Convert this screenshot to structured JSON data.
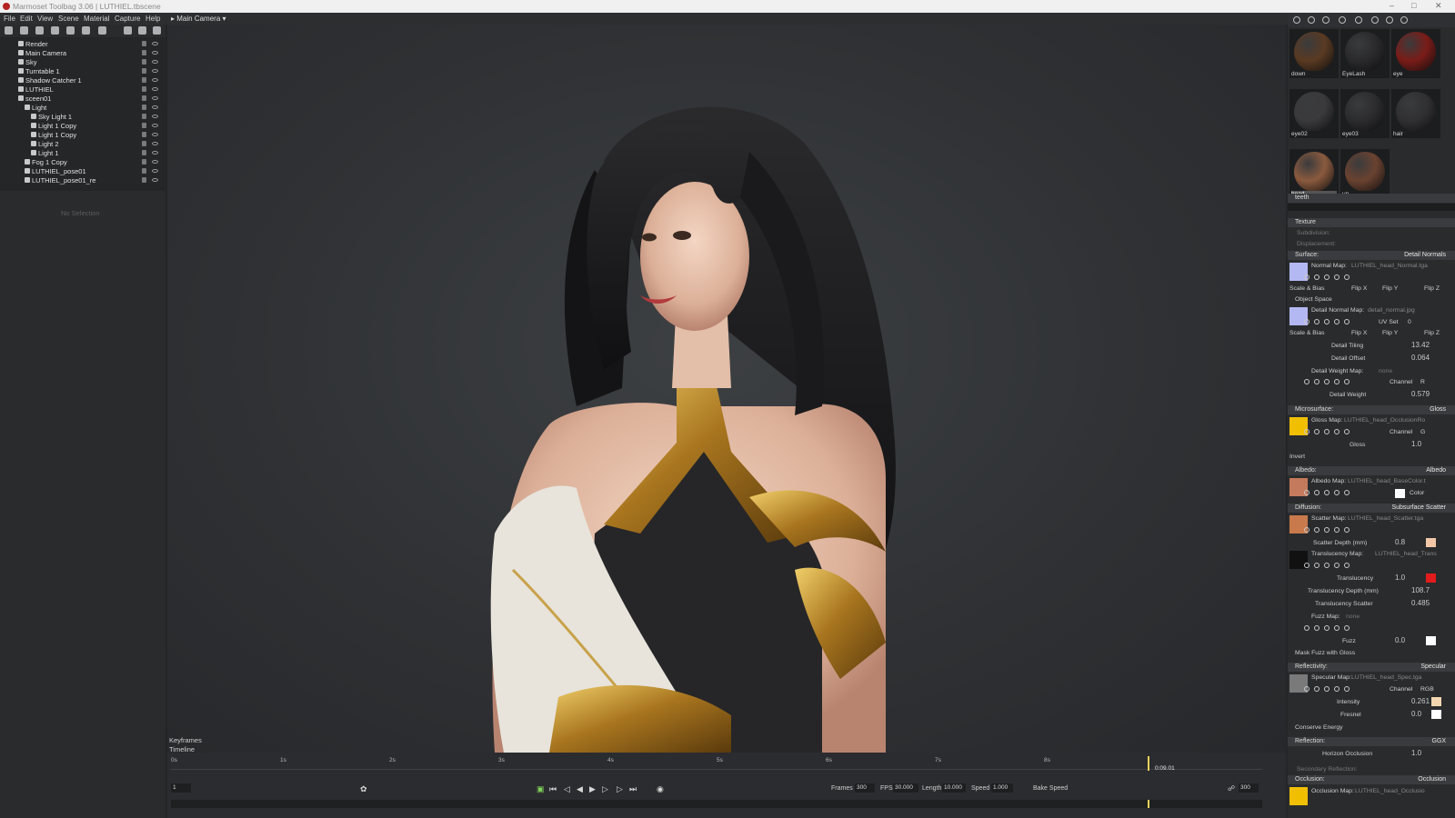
{
  "window": {
    "title": "Marmoset Toolbag 3.06  |  LUTHIEL.tbscene"
  },
  "menu": [
    "File",
    "Edit",
    "View",
    "Scene",
    "Material",
    "Capture",
    "Help"
  ],
  "camera_dropdown": "Main Camera",
  "scene_tree": [
    {
      "label": "Render",
      "indent": 0
    },
    {
      "label": "Main Camera",
      "indent": 0
    },
    {
      "label": "Sky",
      "indent": 0
    },
    {
      "label": "Turntable 1",
      "indent": 0
    },
    {
      "label": "Shadow Catcher 1",
      "indent": 0
    },
    {
      "label": "LUTHIEL",
      "indent": 0
    },
    {
      "label": "sceen01",
      "indent": 0
    },
    {
      "label": "Light",
      "indent": 1
    },
    {
      "label": "Sky Light 1",
      "indent": 2
    },
    {
      "label": "Light 1 Copy",
      "indent": 2
    },
    {
      "label": "Light 1 Copy",
      "indent": 2
    },
    {
      "label": "Light 2",
      "indent": 2
    },
    {
      "label": "Light 1",
      "indent": 2
    },
    {
      "label": "Fog 1 Copy",
      "indent": 1
    },
    {
      "label": "LUTHIEL_pose01",
      "indent": 1
    },
    {
      "label": "LUTHIEL_pose01_re",
      "indent": 1
    }
  ],
  "no_selection": "No Selection",
  "timeline": {
    "keyframes_label": "Keyframes",
    "timeline_label": "Timeline",
    "ticks": [
      "0s",
      "1s",
      "2s",
      "3s",
      "4s",
      "5s",
      "6s",
      "7s",
      "8s"
    ],
    "current_time": "0:09.01",
    "frame_field": "1",
    "frames_label": "Frames",
    "frames": "300",
    "fps_label": "FPS",
    "fps": "30.000",
    "length_label": "Length",
    "length": "10.000",
    "speed_label": "Speed",
    "speed": "1.000",
    "bake_speed": "Bake Speed",
    "end_field": "300"
  },
  "materials": [
    {
      "name": "down",
      "color": "#5a3a22"
    },
    {
      "name": "EyeLash",
      "color": "#2a2a2c"
    },
    {
      "name": "eye",
      "color": "#7a1c18"
    },
    {
      "name": "eye02",
      "color": "#3a3a3c"
    },
    {
      "name": "eye03",
      "color": "#2c2c2e"
    },
    {
      "name": "hair",
      "color": "#303032"
    },
    {
      "name": "head",
      "color": "#8a5a3e"
    },
    {
      "name": "up",
      "color": "#6a4230"
    }
  ],
  "teeth_label": "teeth",
  "props": {
    "texture": "Texture",
    "subdivision": "Subdivision:",
    "displacement": "Displacement:",
    "surface": "Surface:",
    "surface_val": "Detail Normals",
    "normal_map": "Normal Map:",
    "normal_map_file": "LUTHIEL_head_Normal.tga",
    "scale_bias": "Scale & Bias",
    "flip_x": "Flip X",
    "flip_y": "Flip Y",
    "flip_z": "Flip Z",
    "object_space": "Object Space",
    "detail_normal_map": "Detail Normal Map:",
    "detail_normal_file": "detail_normal.jpg",
    "uv_set": "UV Set",
    "uv_set_val": "0",
    "detail_tiling": "Detail Tiling",
    "detail_tiling_val": "13.42",
    "detail_offset": "Detail Offset",
    "detail_offset_val": "0.064",
    "detail_weight_map": "Detail Weight Map:",
    "none": "none",
    "channel": "Channel",
    "channel_r": "R",
    "detail_weight": "Detail Weight",
    "detail_weight_val": "0.579",
    "microsurface": "Microsurface:",
    "microsurface_val": "Gloss",
    "gloss_map": "Gloss Map:",
    "gloss_map_file": "LUTHIEL_head_OcclusionRo",
    "channel_g": "G",
    "gloss": "Gloss",
    "gloss_val": "1.0",
    "invert": "Invert",
    "albedo": "Albedo:",
    "albedo_val": "Albedo",
    "albedo_map": "Albedo Map:",
    "albedo_map_file": "LUTHIEL_head_BaseColor.t",
    "color": "Color",
    "diffusion": "Diffusion:",
    "diffusion_val": "Subsurface Scatter",
    "scatter_map": "Scatter Map:",
    "scatter_map_file": "LUTHIEL_head_Scatter.tga",
    "scatter_depth": "Scatter Depth (mm)",
    "scatter_depth_val": "0.8",
    "translucency_map": "Translucency Map:",
    "translucency_map_file": "LUTHIEL_head_Trans",
    "translucency": "Translucency",
    "translucency_val": "1.0",
    "translucency_depth": "Translucency Depth (mm)",
    "translucency_depth_val": "108.7",
    "translucency_scatter": "Translucency Scatter",
    "translucency_scatter_val": "0.485",
    "fuzz_map": "Fuzz Map:",
    "fuzz": "Fuzz",
    "fuzz_val": "0.0",
    "mask_fuzz": "Mask Fuzz with Gloss",
    "reflectivity": "Reflectivity:",
    "reflectivity_val": "Specular",
    "specular_map": "Specular Map:",
    "specular_map_file": "LUTHIEL_head_Spec.tga",
    "channel_rgb": "RGB",
    "intensity": "Intensity",
    "intensity_val": "0.261",
    "fresnel": "Fresnel",
    "fresnel_val": "0.0",
    "conserve": "Conserve Energy",
    "reflection": "Reflection:",
    "reflection_val": "GGX",
    "horizon_occlusion": "Horizon Occlusion",
    "horizon_occlusion_val": "1.0",
    "secondary_reflection": "Secondary Reflection:",
    "occlusion": "Occlusion:",
    "occlusion_val": "Occlusion",
    "occlusion_map": "Occlusion Map:",
    "occlusion_map_file": "LUTHIEL_head_Occlusio"
  },
  "colors": {
    "accent_timeline": "#e8d25a",
    "translucency_swatch": "#e21c1c",
    "scatter_swatch": "#f1c7a8",
    "gloss_swatch": "#f0c000",
    "normal_swatch": "#b4b8f2"
  }
}
